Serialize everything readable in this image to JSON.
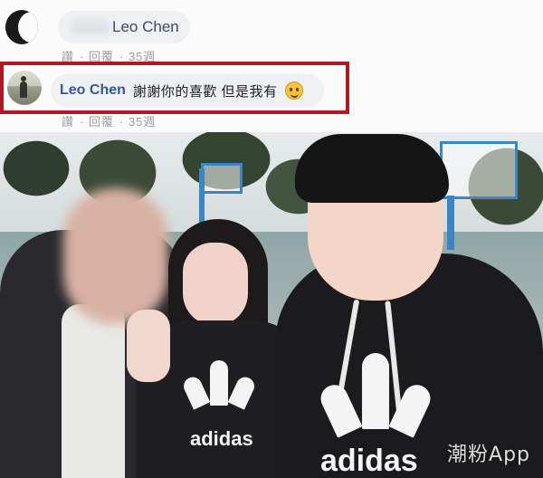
{
  "comments": [
    {
      "author": "Leo Chen",
      "actions": [
        "讚",
        "回覆"
      ],
      "time": "35週"
    },
    {
      "author": "Leo Chen",
      "text": "謝謝你的喜歡 但是我有",
      "emoji": "grin-emoji",
      "actions": [
        "讚",
        "回覆"
      ],
      "time": "35週",
      "highlight_color": "#b01822"
    }
  ],
  "photo": {
    "shirt_brand": "adidas",
    "watermark": "潮粉App"
  },
  "colors": {
    "name": "#365899",
    "bubble": "#eef0f3",
    "meta": "#9aa0a8",
    "hoop": "#3a86c4"
  }
}
